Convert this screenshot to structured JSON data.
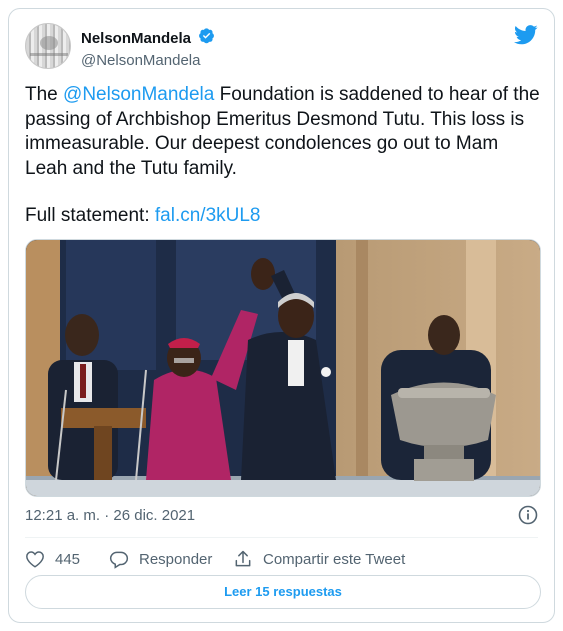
{
  "author": {
    "display_name": "NelsonMandela",
    "handle": "@NelsonMandela"
  },
  "icons": {
    "verified": "verified-badge-icon",
    "brand": "twitter-bird-icon",
    "info": "info-icon",
    "like": "heart-icon",
    "reply": "speech-bubble-icon",
    "share": "share-upload-icon"
  },
  "tweet": {
    "text_before_mention": "The ",
    "mention": "@NelsonMandela",
    "text_after_mention": " Foundation is saddened to hear of the passing of Archbishop Emeritus Desmond Tutu. This loss is immeasurable. Our deepest condolences go out to Mam Leah and the Tutu family.",
    "statement_label": "Full statement: ",
    "statement_link": "fal.cn/3kUL8"
  },
  "timestamp": "12:21 a. m. · 26 dic. 2021",
  "actions": {
    "likes_count": "445",
    "reply_label": "Responder",
    "share_label": "Compartir este Tweet"
  },
  "replies_button": "Leer 15 respuestas",
  "colors": {
    "accent": "#1d9bf0",
    "text": "#0f1419",
    "muted": "#536471",
    "border": "#cfd9de"
  }
}
